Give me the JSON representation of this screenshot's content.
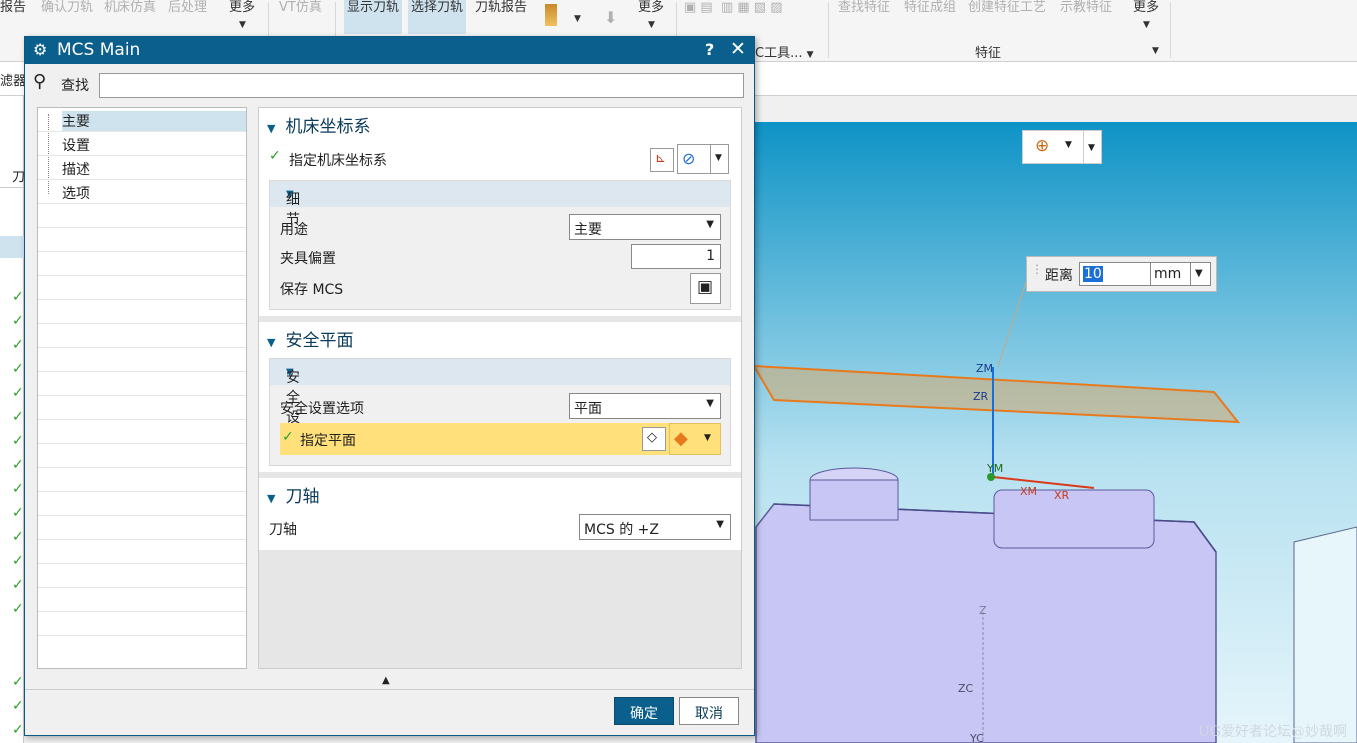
{
  "ribbon": {
    "items": [
      {
        "label": "报告",
        "dim": false
      },
      {
        "label": "确认刀轨",
        "dim": true
      },
      {
        "label": "机床仿真",
        "dim": true
      },
      {
        "label": "后处理",
        "dim": true
      },
      {
        "label": "更多",
        "dim": false
      },
      {
        "label": "VT仿真",
        "dim": true
      },
      {
        "label": "显示刀轨",
        "dim": false
      },
      {
        "label": "选择刀轨",
        "dim": false
      },
      {
        "label": "刀轨报告",
        "dim": false
      },
      {
        "label": "更多",
        "dim": false
      },
      {
        "label": "查找特征",
        "dim": true
      },
      {
        "label": "特征成组",
        "dim": true
      },
      {
        "label": "创建特征工艺",
        "dim": true
      },
      {
        "label": "示教特征",
        "dim": true
      },
      {
        "label": "更多",
        "dim": false
      }
    ],
    "group_labels": [
      "C工具...",
      "特征"
    ],
    "filter_label": "滤器"
  },
  "dialog": {
    "title": "MCS Main",
    "help": "?",
    "close": "✕",
    "find_label": "查找",
    "nav": [
      "主要",
      "设置",
      "描述",
      "选项"
    ],
    "sections": {
      "mcs": {
        "title": "机床坐标系",
        "specify": "指定机床坐标系",
        "details": "细节",
        "purpose_label": "用途",
        "purpose_value": "主要",
        "fixture_label": "夹具偏置",
        "fixture_value": "1",
        "save_label": "保存 MCS"
      },
      "safety": {
        "title": "安全平面",
        "settings": "安全设置",
        "option_label": "安全设置选项",
        "option_value": "平面",
        "specify_plane": "指定平面"
      },
      "axis": {
        "title": "刀轴",
        "label": "刀轴",
        "value": "MCS 的 +Z"
      }
    },
    "ok": "确定",
    "cancel": "取消"
  },
  "viewport": {
    "distance_label": "距离",
    "distance_value": "10",
    "distance_unit": "mm",
    "axis_labels": [
      "ZM",
      "ZR",
      "YM",
      "XM",
      "XR",
      "Z",
      "ZC",
      "YC"
    ],
    "watermark": "UG爱好者论坛@妙哉啊"
  },
  "colors": {
    "title_bar": "#0a5f8c",
    "highlight": "#ffe07a",
    "check": "#2ca02c",
    "plane": "#e87a1e"
  }
}
